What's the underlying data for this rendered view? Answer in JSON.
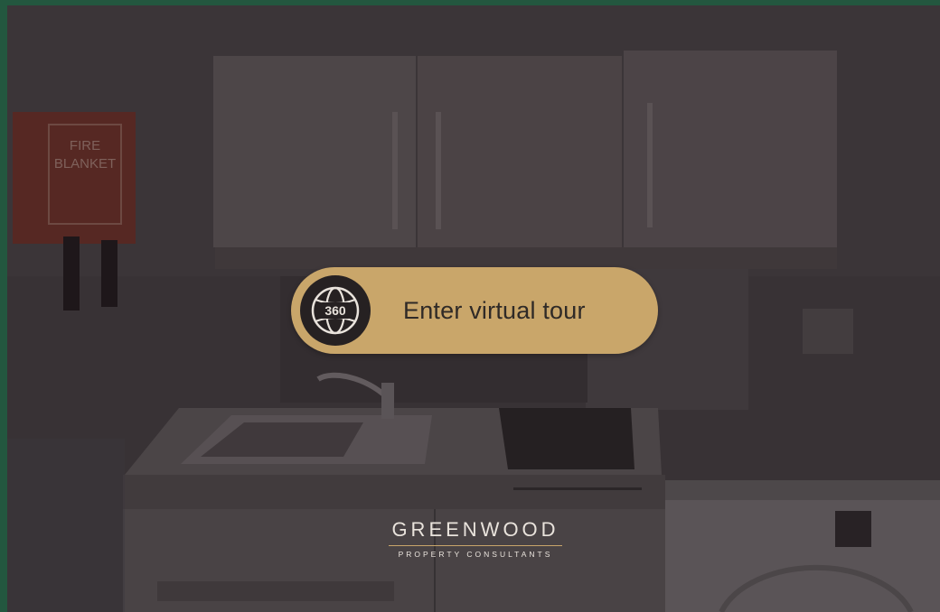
{
  "tour_button": {
    "label": "Enter virtual tour",
    "icon": "360-globe-icon",
    "icon_text": "360"
  },
  "brand": {
    "name": "GREENWOOD",
    "tagline": "PROPERTY CONSULTANTS"
  },
  "scene": {
    "fire_blanket_sign_line1": "FIRE",
    "fire_blanket_sign_line2": "BLANKET"
  },
  "colors": {
    "frame": "#23573f",
    "button": "#c9a66a",
    "icon_bg": "#262122"
  }
}
